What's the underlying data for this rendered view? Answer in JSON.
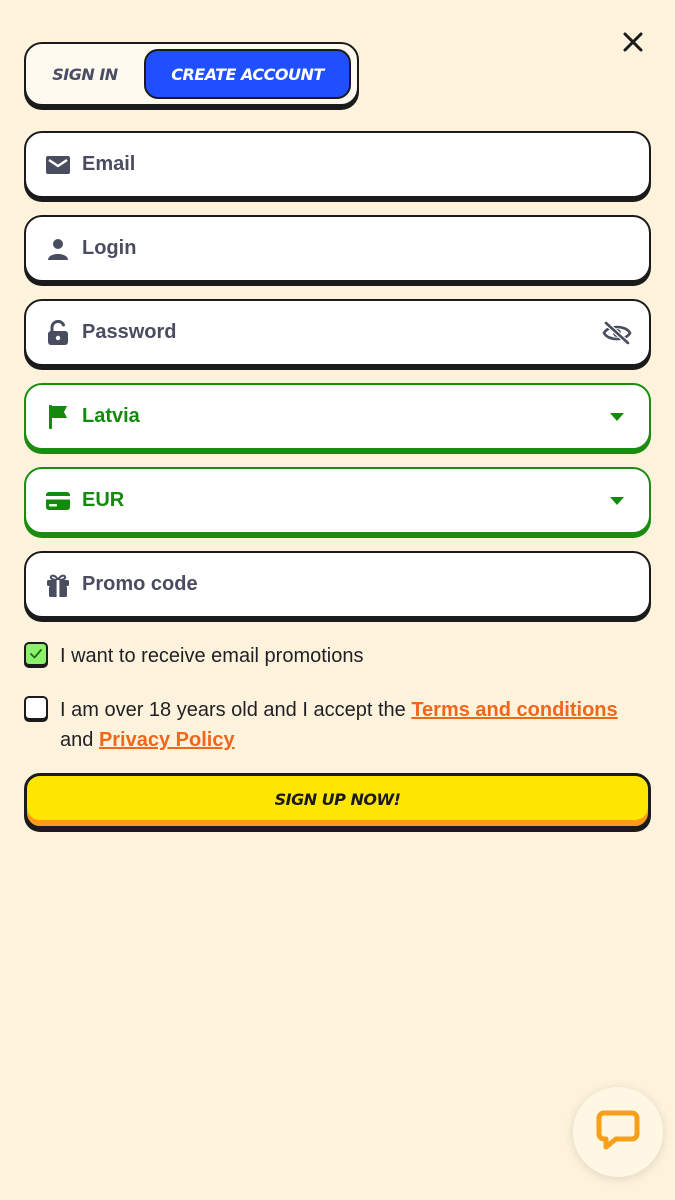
{
  "tabs": {
    "signin_label": "SIGN IN",
    "create_label": "CREATE ACCOUNT",
    "active": "create"
  },
  "close": {
    "icon": "close-icon"
  },
  "form": {
    "email": {
      "placeholder": "Email",
      "value": "",
      "icon": "envelope-icon"
    },
    "login": {
      "placeholder": "Login",
      "value": "",
      "icon": "user-icon"
    },
    "password": {
      "placeholder": "Password",
      "value": "",
      "icon": "lock-open-icon",
      "toggle_icon": "eye-slash-icon"
    },
    "country": {
      "value": "Latvia",
      "icon": "flag-icon",
      "dropdown_icon": "caret-down-icon"
    },
    "currency": {
      "value": "EUR",
      "icon": "credit-card-icon",
      "dropdown_icon": "caret-down-icon"
    },
    "promo": {
      "placeholder": "Promo code",
      "value": "",
      "icon": "gift-icon"
    }
  },
  "consents": {
    "promotions": {
      "label": "I want to receive email promotions",
      "checked": true
    },
    "age": {
      "prefix": "I am over 18 years old and I accept the ",
      "terms_link": "Terms and conditions",
      "middle": "and ",
      "privacy_link": "Privacy Policy",
      "checked": false
    }
  },
  "submit": {
    "label": "SIGN UP NOW!"
  },
  "chat": {
    "icon": "chat-bubble-icon"
  },
  "colors": {
    "background": "#fdf3dc",
    "accent_blue": "#1f4fff",
    "valid_green": "#1b8c0f",
    "link_orange": "#f2661b",
    "button_yellow": "#ffe600"
  }
}
